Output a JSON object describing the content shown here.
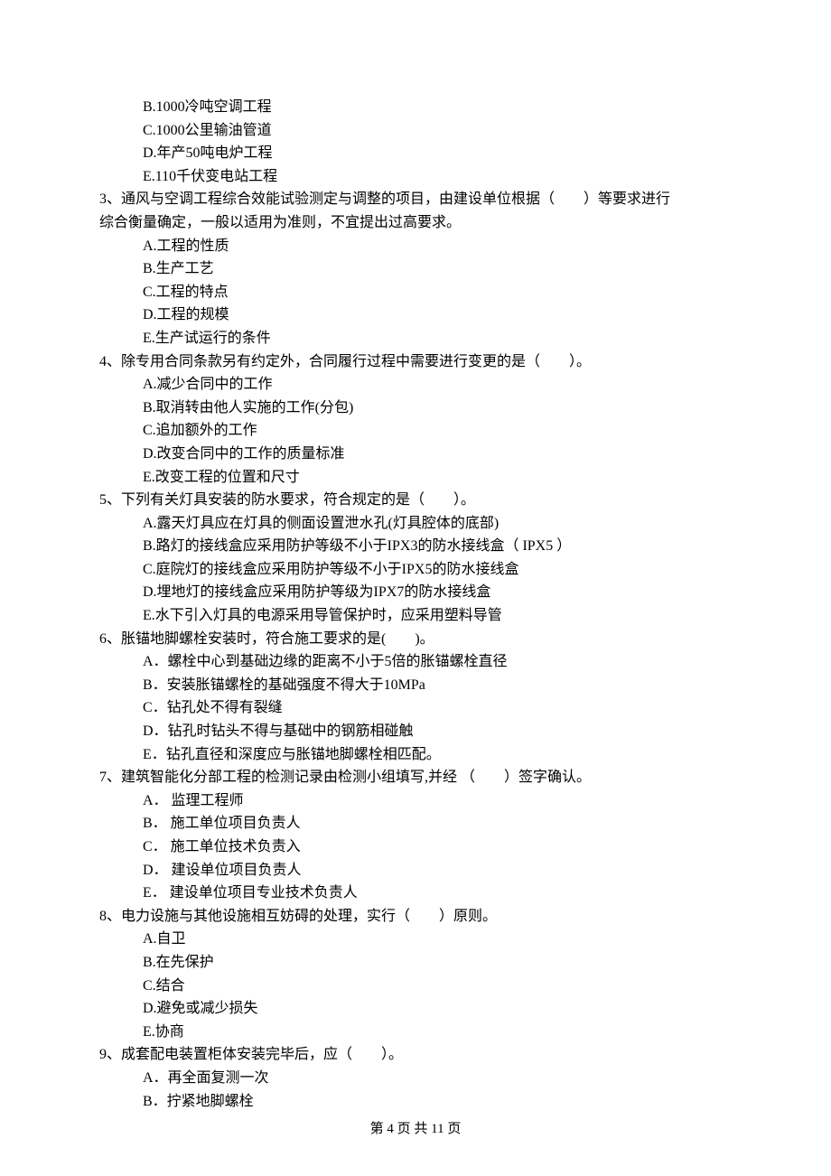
{
  "pre_options": {
    "B": "B.1000冷吨空调工程",
    "C": "C.1000公里输油管道",
    "D": "D.年产50吨电炉工程",
    "E": "E.110千伏变电站工程"
  },
  "q3": {
    "stem_line1": "3、通风与空调工程综合效能试验测定与调整的项目，由建设单位根据（　　）等要求进行",
    "stem_line2": "综合衡量确定，一般以适用为准则，不宜提出过高要求。",
    "A": "A.工程的性质",
    "B": "B.生产工艺",
    "C": "C.工程的特点",
    "D": "D.工程的规模",
    "E": "E.生产试运行的条件"
  },
  "q4": {
    "stem": "4、除专用合同条款另有约定外，合同履行过程中需要进行变更的是（　　）。",
    "A": "A.减少合同中的工作",
    "B": "B.取消转由他人实施的工作(分包)",
    "C": "C.追加额外的工作",
    "D": "D.改变合同中的工作的质量标准",
    "E": "E.改变工程的位置和尺寸"
  },
  "q5": {
    "stem": "5、下列有关灯具安装的防水要求，符合规定的是（　　）。",
    "A": "A.露天灯具应在灯具的侧面设置泄水孔(灯具腔体的底部)",
    "B": "B.路灯的接线盒应采用防护等级不小于IPX3的防水接线盒（ IPX5 ）",
    "C": "C.庭院灯的接线盒应采用防护等级不小于IPX5的防水接线盒",
    "D": "D.埋地灯的接线盒应采用防护等级为IPX7的防水接线盒",
    "E": "E.水下引入灯具的电源采用导管保护时，应采用塑料导管"
  },
  "q6": {
    "stem": "6、胀锚地脚螺栓安装时，符合施工要求的是(　　)。",
    "A": "A．螺栓中心到基础边缘的距离不小于5倍的胀锚螺栓直径",
    "B": "B．安装胀锚螺栓的基础强度不得大于10MPa",
    "C": "C．钻孔处不得有裂缝",
    "D": "D．钻孔时钻头不得与基础中的钢筋相碰触",
    "E": "E．钻孔直径和深度应与胀锚地脚螺栓相匹配。"
  },
  "q7": {
    "stem": "7、建筑智能化分部工程的检测记录由检测小组填写,并经 （　　）签字确认。",
    "A": "A． 监理工程师",
    "B": "B． 施工单位项目负责人",
    "C": "C． 施工单位技术负责入",
    "D": "D． 建设单位项目负责人",
    "E": "E． 建设单位项目专业技术负责人"
  },
  "q8": {
    "stem": "8、电力设施与其他设施相互妨碍的处理，实行（　　）原则。",
    "A": "A.自卫",
    "B": "B.在先保护",
    "C": "C.结合",
    "D": "D.避免或减少损失",
    "E": "E.协商"
  },
  "q9": {
    "stem": "9、成套配电装置柜体安装完毕后，应（　　）。",
    "A": "A．再全面复测一次",
    "B": "B．拧紧地脚螺栓"
  },
  "footer": "第 4 页 共 11 页"
}
